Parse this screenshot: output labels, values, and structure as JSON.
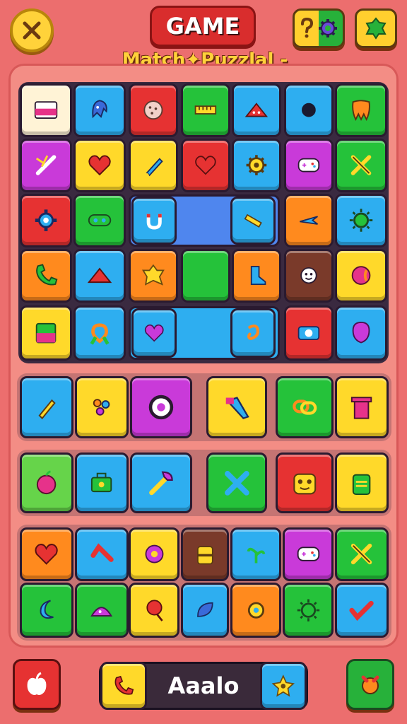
{
  "header": {
    "title": "GAME",
    "subtitle": "Match✦Puzzlal -"
  },
  "top_buttons": {
    "close_icon": "close-icon",
    "settings_icons": [
      "question-icon",
      "gear-icon"
    ],
    "shop_icon": "gem-icon"
  },
  "bottom_bar": {
    "label": "Aaalo",
    "left_icon": "apple-icon",
    "phone_icon": "phone-icon",
    "right_tile_icon": "star-icon",
    "right_button_icon": "candy-icon"
  },
  "colors": {
    "background": "#ec6e6e",
    "board": "#f38d85",
    "accent_yellow": "#ffd23a",
    "accent_red": "#d92d2d"
  }
}
